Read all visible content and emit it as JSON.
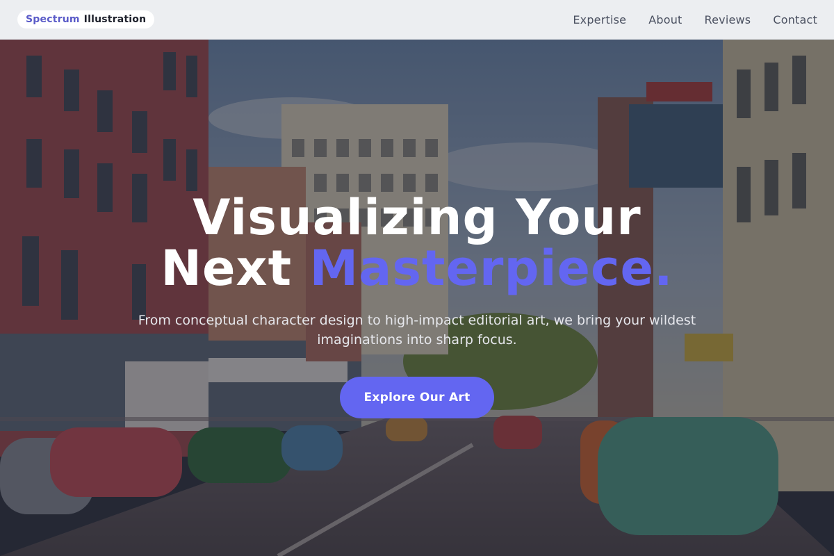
{
  "brand": {
    "name_part1": "Spectrum",
    "name_part2": "Illustration"
  },
  "nav": {
    "items": [
      {
        "label": "Expertise"
      },
      {
        "label": "About"
      },
      {
        "label": "Reviews"
      },
      {
        "label": "Contact"
      }
    ]
  },
  "hero": {
    "headline_line1": "Visualizing Your",
    "headline_line2_plain": "Next",
    "headline_line2_accent": "Masterpiece.",
    "subtitle": "From conceptual character design to high-impact editorial art, we bring your wildest imaginations into sharp focus.",
    "cta_label": "Explore Our Art",
    "background_image": "vintage-street-postcard"
  },
  "colors": {
    "accent": "#6366f1",
    "brand_accent": "#5a5bc8",
    "nav_background": "#eceef1",
    "headline": "#ffffff"
  }
}
